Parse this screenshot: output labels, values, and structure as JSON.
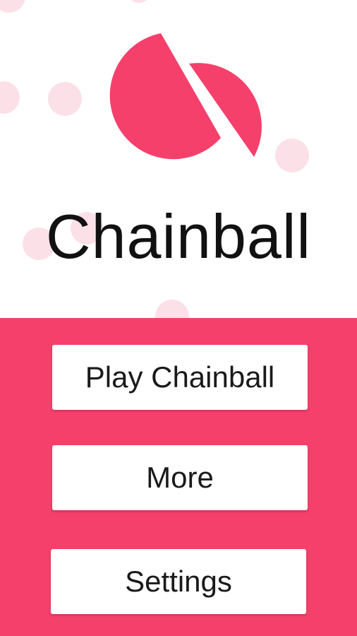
{
  "app": {
    "title": "Chainball"
  },
  "logo": {
    "icon": "split-ball-icon",
    "color": "#f5406c"
  },
  "menu": {
    "background": "#f5406c",
    "buttons": [
      {
        "label": "Play Chainball"
      },
      {
        "label": "More"
      },
      {
        "label": "Settings"
      }
    ]
  },
  "decor": {
    "bubble_color": "#fbe1e7"
  }
}
